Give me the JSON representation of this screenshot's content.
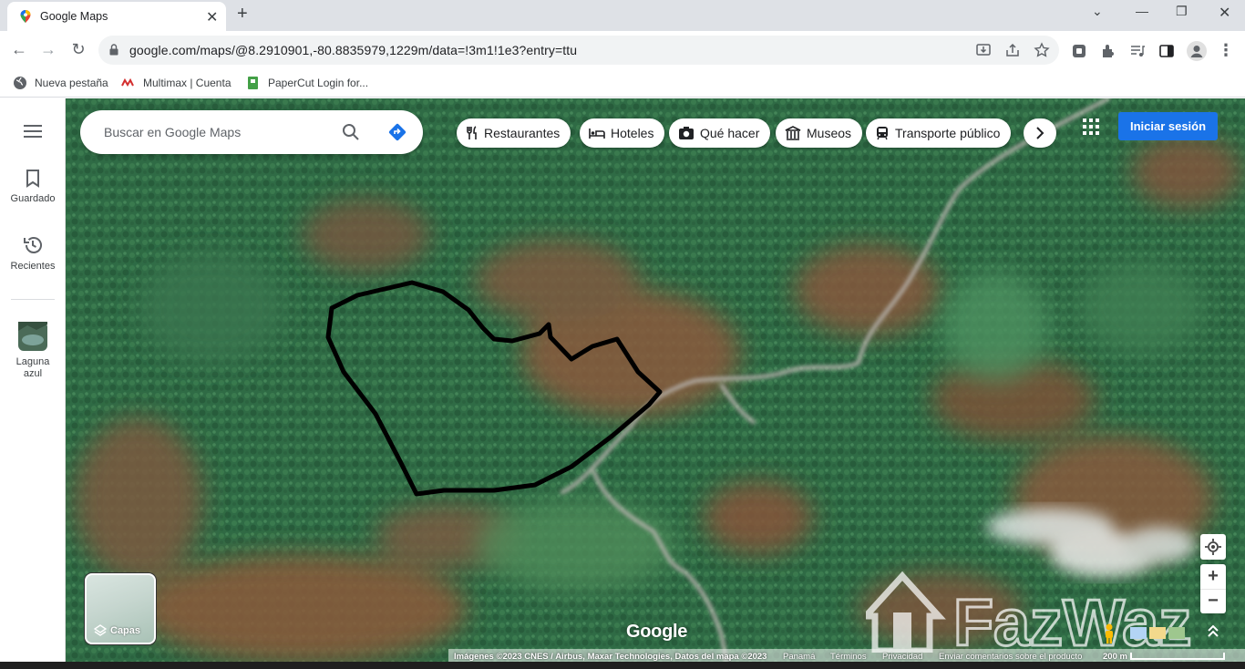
{
  "browser": {
    "tab_title": "Google Maps",
    "url": "google.com/maps/@8.2910901,-80.8835979,1229m/data=!3m1!1e3?entry=ttu",
    "bookmarks": [
      {
        "label": "Nueva pestaña",
        "icon": "globe-icon"
      },
      {
        "label": "Multimax | Cuenta",
        "icon": "multimax-icon"
      },
      {
        "label": "PaperCut Login for...",
        "icon": "papercut-icon"
      }
    ]
  },
  "sidebar": {
    "items": [
      {
        "label": "Guardado",
        "icon": "bookmark-icon"
      },
      {
        "label": "Recientes",
        "icon": "history-icon"
      },
      {
        "label": "Laguna azul",
        "icon": "place-thumbnail"
      }
    ]
  },
  "search": {
    "placeholder": "Buscar en Google Maps"
  },
  "chips": [
    {
      "label": "Restaurantes",
      "icon": "restaurant-icon"
    },
    {
      "label": "Hoteles",
      "icon": "hotel-icon"
    },
    {
      "label": "Qué hacer",
      "icon": "camera-icon"
    },
    {
      "label": "Museos",
      "icon": "museum-icon"
    },
    {
      "label": "Transporte público",
      "icon": "transit-icon"
    }
  ],
  "signin_label": "Iniciar sesión",
  "layers_label": "Capas",
  "map_logo": "Google",
  "footer": {
    "attribution": "Imágenes ©2023 CNES / Airbus, Maxar Technologies, Datos del mapa ©2023",
    "country": "Panamá",
    "terms": "Términos",
    "privacy": "Privacidad",
    "feedback": "Enviar comentarios sobre el producto",
    "scale": "200 m"
  },
  "watermark": "FazWaz",
  "colors": {
    "signin_blue": "#1a73e8",
    "directions_blue": "#1a73e8",
    "forest_green": "#2f6b45",
    "cleared_land": "#8a5a3e",
    "road_gray": "#b7b3ad",
    "outline_black": "#000000"
  }
}
